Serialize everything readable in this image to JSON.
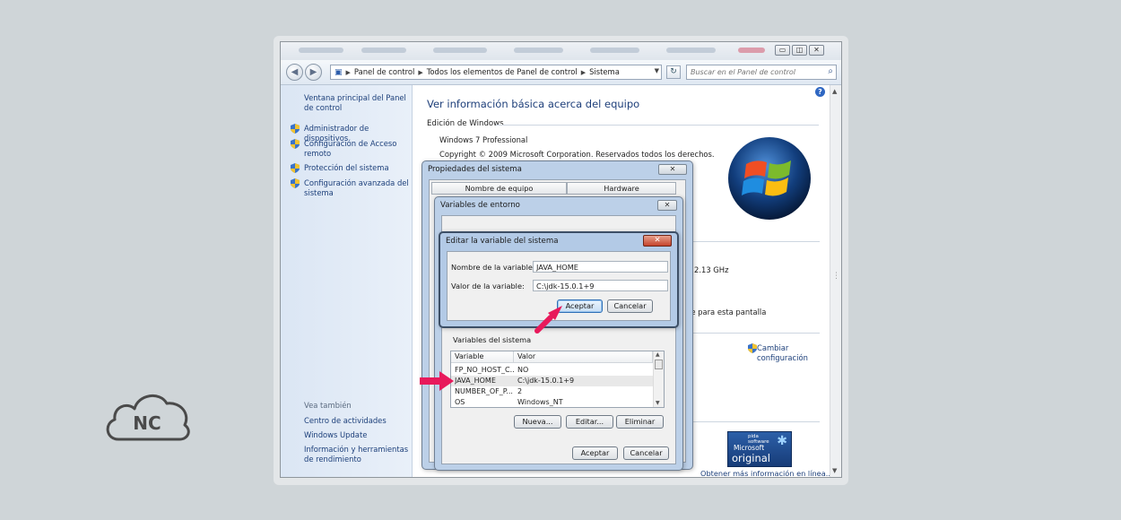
{
  "brand": {
    "logo_text": "NC",
    "accent": "#e8195b"
  },
  "window": {
    "controls": {
      "minimize": "▭",
      "maximize": "◫",
      "close": "✕"
    }
  },
  "address_bar": {
    "crumbs": [
      "Panel de control",
      "Todos los elementos de Panel de control",
      "Sistema"
    ],
    "search_placeholder": "Buscar en el Panel de control"
  },
  "left_pane": {
    "home_link": "Ventana principal del Panel de control",
    "tasks": [
      "Administrador de dispositivos",
      "Configuración de Acceso remoto",
      "Protección del sistema",
      "Configuración avanzada del sistema"
    ],
    "see_also_heading": "Vea también",
    "see_also": [
      "Centro de actividades",
      "Windows Update",
      "Información y herramientas de rendimiento"
    ]
  },
  "main": {
    "title": "Ver información básica acerca del equipo",
    "edition_heading": "Edición de Windows",
    "edition": "Windows 7 Professional",
    "copyright": "Copyright © 2009 Microsoft Corporation. Reservados todos los derechos.",
    "processor_speed": "2.13 GHz",
    "pen_touch_fragment": "le para esta pantalla",
    "change_settings": "Cambiar configuración",
    "genuine": {
      "line1": "pida",
      "line2": "software",
      "line3": "Microsoft",
      "line4": "original"
    },
    "more_info": "Obtener más información en línea..."
  },
  "system_properties": {
    "title": "Propiedades del sistema",
    "tabs": [
      "Nombre de equipo",
      "Hardware"
    ],
    "close": "✕"
  },
  "env_vars": {
    "title": "Variables de entorno",
    "close": "✕",
    "system_vars_label": "Variables del sistema",
    "columns": [
      "Variable",
      "Valor"
    ],
    "rows": [
      {
        "variable": "FP_NO_HOST_C...",
        "valor": "NO"
      },
      {
        "variable": "JAVA_HOME",
        "valor": "C:\\jdk-15.0.1+9"
      },
      {
        "variable": "NUMBER_OF_P...",
        "valor": "2"
      },
      {
        "variable": "OS",
        "valor": "Windows_NT"
      }
    ],
    "buttons": {
      "new": "Nueva...",
      "edit": "Editar...",
      "delete": "Eliminar"
    },
    "ok": "Aceptar",
    "cancel": "Cancelar"
  },
  "edit_var": {
    "title": "Editar la variable del sistema",
    "close": "✕",
    "name_label": "Nombre de la variable:",
    "name_value": "JAVA_HOME",
    "value_label": "Valor de la variable:",
    "value_value": "C:\\jdk-15.0.1+9",
    "ok": "Aceptar",
    "cancel": "Cancelar"
  }
}
